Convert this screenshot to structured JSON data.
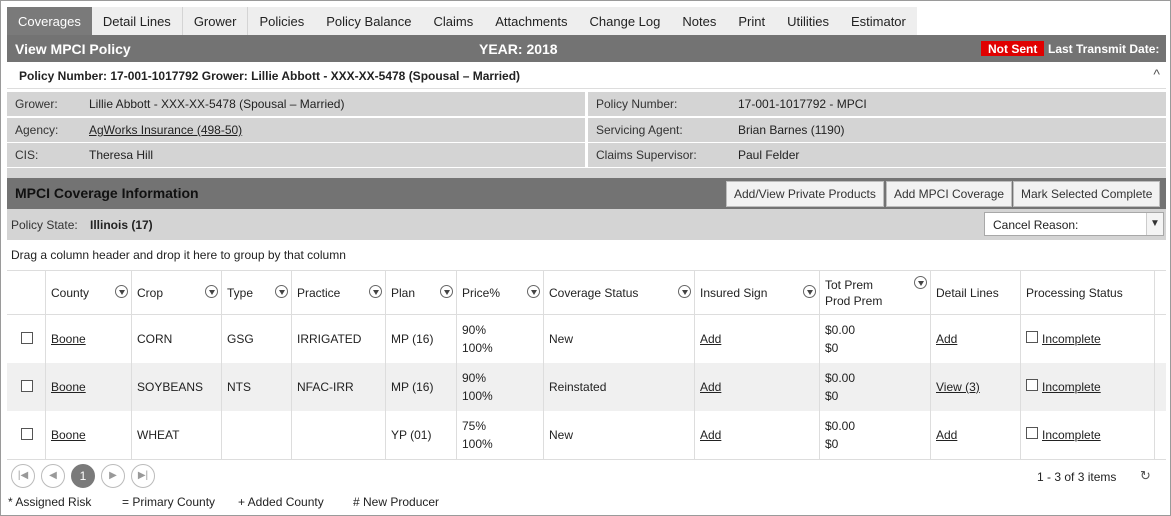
{
  "tabs": [
    "Coverages",
    "Detail Lines",
    "Grower",
    "Policies",
    "Policy Balance",
    "Claims",
    "Attachments",
    "Change Log",
    "Notes",
    "Print",
    "Utilities",
    "Estimator"
  ],
  "header": {
    "title": "View MPCI Policy",
    "year": "YEAR: 2018",
    "status_badge": "Not Sent",
    "last_transmit": "Last Transmit Date:"
  },
  "policy_line": {
    "text": "Policy Number: 17-001-1017792 Grower: Lillie Abbott - XXX-XX-5478 (Spousal – Married)",
    "collapse_icon": "^"
  },
  "info": {
    "grower_label": "Grower:",
    "grower_value": "Lillie Abbott - XXX-XX-5478 (Spousal – Married)",
    "agency_label": "Agency:",
    "agency_value": "AgWorks Insurance (498-50)",
    "cis_label": "CIS:",
    "cis_value": "Theresa Hill",
    "policy_number_label": "Policy Number:",
    "policy_number_value": "17-001-1017792 - MPCI",
    "servicing_agent_label": "Servicing Agent:",
    "servicing_agent_value": "Brian Barnes (1190)",
    "claims_supervisor_label": "Claims Supervisor:",
    "claims_supervisor_value": "Paul Felder"
  },
  "coverage": {
    "title": "MPCI Coverage Information",
    "btn_private": "Add/View Private Products",
    "btn_add": "Add MPCI Coverage",
    "btn_complete": "Mark Selected Complete",
    "policy_state_label": "Policy State:",
    "policy_state_value": "Illinois (17)",
    "cancel_reason": "Cancel Reason:",
    "group_hint": "Drag a column header and drop it here to group by that column"
  },
  "grid": {
    "headers": {
      "county": "County",
      "crop": "Crop",
      "type": "Type",
      "practice": "Practice",
      "plan": "Plan",
      "price": "Price%",
      "coverage_status": "Coverage Status",
      "insured_sign": "Insured Sign",
      "tot_prem": "Tot Prem",
      "prod_prem": "Prod Prem",
      "detail_lines": "Detail Lines",
      "processing_status": "Processing Status"
    },
    "rows": [
      {
        "county": "Boone",
        "crop": "CORN",
        "type": "GSG",
        "practice": "IRRIGATED",
        "plan": "MP (16)",
        "price1": "90%",
        "price2": "100%",
        "status": "New",
        "insured": "Add",
        "tot": "$0.00",
        "prod": "$0",
        "detail": "Add",
        "processing": "Incomplete"
      },
      {
        "county": "Boone",
        "crop": "SOYBEANS",
        "type": "NTS",
        "practice": "NFAC-IRR",
        "plan": "MP (16)",
        "price1": "90%",
        "price2": "100%",
        "status": "Reinstated",
        "insured": "Add",
        "tot": "$0.00",
        "prod": "$0",
        "detail": "View (3)",
        "processing": "Incomplete"
      },
      {
        "county": "Boone",
        "crop": "WHEAT",
        "type": "",
        "practice": "",
        "plan": "YP (01)",
        "price1": "75%",
        "price2": "100%",
        "status": "New",
        "insured": "Add",
        "tot": "$0.00",
        "prod": "$0",
        "detail": "Add",
        "processing": "Incomplete"
      }
    ]
  },
  "pager": {
    "current_page": "1",
    "info": "1 - 3 of 3 items"
  },
  "legend": [
    "* Assigned Risk",
    "= Primary County",
    "+ Added County",
    "# New Producer"
  ]
}
